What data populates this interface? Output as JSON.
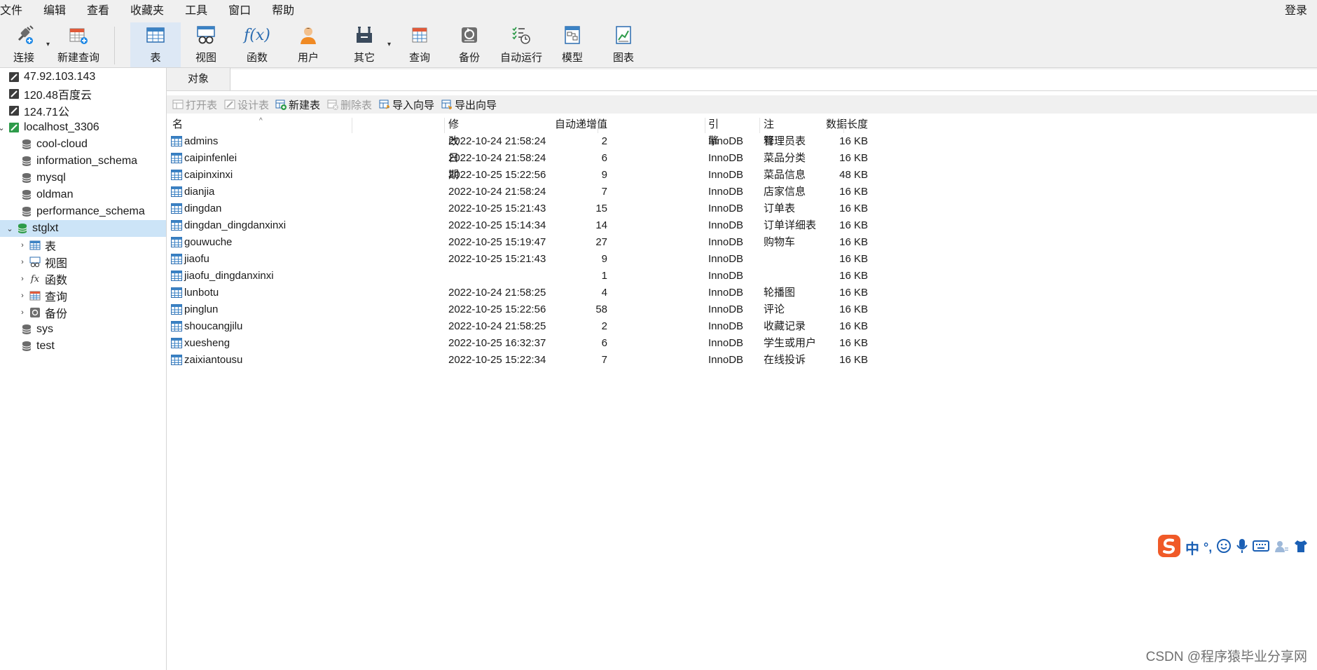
{
  "menu": [
    "文件",
    "编辑",
    "查看",
    "收藏夹",
    "工具",
    "窗口",
    "帮助"
  ],
  "login": "登录",
  "toolbar": {
    "connect": "连接",
    "new_query": "新建查询",
    "table": "表",
    "view": "视图",
    "function": "函数",
    "user": "用户",
    "other": "其它",
    "query": "查询",
    "backup": "备份",
    "auto_run": "自动运行",
    "model": "模型",
    "chart": "图表"
  },
  "sidebar": {
    "connections": [
      {
        "label": "47.92.103.143",
        "icon": "server-disconnected-icon"
      },
      {
        "label": "120.48百度云",
        "icon": "server-disconnected-icon"
      },
      {
        "label": "124.71公",
        "icon": "server-disconnected-icon"
      },
      {
        "label": "localhost_3306",
        "icon": "server-connected-icon"
      }
    ],
    "databases": [
      {
        "label": "cool-cloud"
      },
      {
        "label": "information_schema"
      },
      {
        "label": "mysql"
      },
      {
        "label": "oldman"
      },
      {
        "label": "performance_schema"
      },
      {
        "label": "stglxt"
      }
    ],
    "stglxt_children": [
      {
        "label": "表",
        "icon": "table-icon"
      },
      {
        "label": "视图",
        "icon": "view-icon"
      },
      {
        "label": "函数",
        "icon": "function-icon"
      },
      {
        "label": "查询",
        "icon": "query-icon"
      },
      {
        "label": "备份",
        "icon": "backup-icon"
      }
    ],
    "databases_after": [
      {
        "label": "sys"
      },
      {
        "label": "test"
      }
    ]
  },
  "tabs": {
    "objects": "对象"
  },
  "object_toolbar": {
    "open_table": "打开表",
    "design_table": "设计表",
    "new_table": "新建表",
    "delete_table": "删除表",
    "import_wizard": "导入向导",
    "export_wizard": "导出向导"
  },
  "columns": {
    "name": "名",
    "auto_increment": "自动递增值",
    "modified": "修改日期",
    "data_length": "数据长度",
    "engine": "引擎",
    "comment": "注释"
  },
  "rows": [
    {
      "name": "admins",
      "auto": "2",
      "modified": "2022-10-24 21:58:24",
      "size": "16 KB",
      "engine": "InnoDB",
      "comment": "管理员表"
    },
    {
      "name": "caipinfenlei",
      "auto": "6",
      "modified": "2022-10-24 21:58:24",
      "size": "16 KB",
      "engine": "InnoDB",
      "comment": "菜品分类"
    },
    {
      "name": "caipinxinxi",
      "auto": "9",
      "modified": "2022-10-25 15:22:56",
      "size": "48 KB",
      "engine": "InnoDB",
      "comment": "菜品信息"
    },
    {
      "name": "dianjia",
      "auto": "7",
      "modified": "2022-10-24 21:58:24",
      "size": "16 KB",
      "engine": "InnoDB",
      "comment": "店家信息"
    },
    {
      "name": "dingdan",
      "auto": "15",
      "modified": "2022-10-25 15:21:43",
      "size": "16 KB",
      "engine": "InnoDB",
      "comment": "订单表"
    },
    {
      "name": "dingdan_dingdanxinxi",
      "auto": "14",
      "modified": "2022-10-25 15:14:34",
      "size": "16 KB",
      "engine": "InnoDB",
      "comment": "订单详细表"
    },
    {
      "name": "gouwuche",
      "auto": "27",
      "modified": "2022-10-25 15:19:47",
      "size": "16 KB",
      "engine": "InnoDB",
      "comment": "购物车"
    },
    {
      "name": "jiaofu",
      "auto": "9",
      "modified": "2022-10-25 15:21:43",
      "size": "16 KB",
      "engine": "InnoDB",
      "comment": ""
    },
    {
      "name": "jiaofu_dingdanxinxi",
      "auto": "1",
      "modified": "",
      "size": "16 KB",
      "engine": "InnoDB",
      "comment": ""
    },
    {
      "name": "lunbotu",
      "auto": "4",
      "modified": "2022-10-24 21:58:25",
      "size": "16 KB",
      "engine": "InnoDB",
      "comment": "轮播图"
    },
    {
      "name": "pinglun",
      "auto": "58",
      "modified": "2022-10-25 15:22:56",
      "size": "16 KB",
      "engine": "InnoDB",
      "comment": "评论"
    },
    {
      "name": "shoucangjilu",
      "auto": "2",
      "modified": "2022-10-24 21:58:25",
      "size": "16 KB",
      "engine": "InnoDB",
      "comment": "收藏记录"
    },
    {
      "name": "xuesheng",
      "auto": "6",
      "modified": "2022-10-25 16:32:37",
      "size": "16 KB",
      "engine": "InnoDB",
      "comment": "学生或用户"
    },
    {
      "name": "zaixiantousu",
      "auto": "7",
      "modified": "2022-10-25 15:22:34",
      "size": "16 KB",
      "engine": "InnoDB",
      "comment": "在线投诉"
    }
  ],
  "ime": {
    "mode": "中",
    "punct": "°,"
  },
  "watermark": "CSDN @程序猿毕业分享网"
}
